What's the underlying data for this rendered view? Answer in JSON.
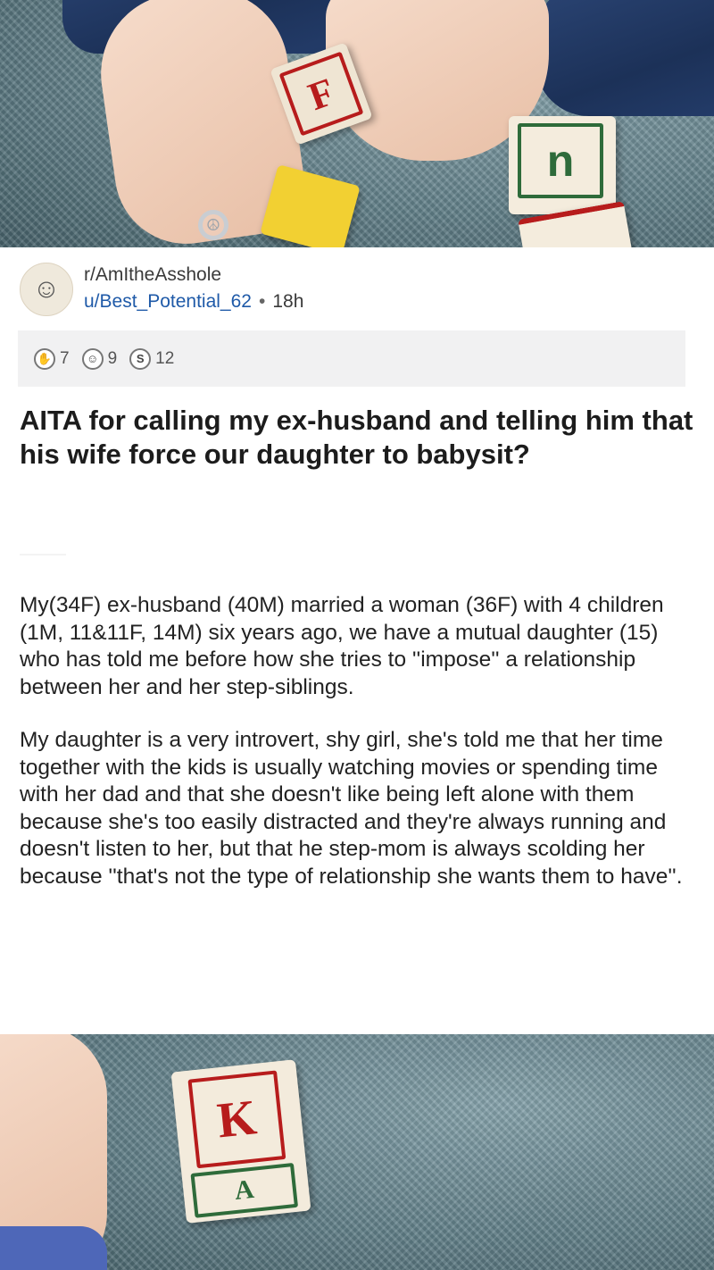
{
  "post": {
    "subreddit": "r/AmItheAsshole",
    "username": "u/Best_Potential_62",
    "age": "18h",
    "awards": [
      {
        "icon": "hands-icon",
        "count": "7"
      },
      {
        "icon": "wholesome-icon",
        "count": "9"
      },
      {
        "icon": "silver-icon",
        "count": "12"
      }
    ],
    "title": "AITA for calling my ex-husband and telling him that his wife force our daughter to babysit?",
    "paragraphs": [
      "My(34F) ex-husband (40M) married a woman (36F) with 4 children (1M, 11&11F, 14M) six years ago, we have a mutual daughter (15) who has told me before how she tries to ''impose'' a relationship between her and her step-siblings.",
      "My daughter is a very introvert, shy girl, she's told me that her time together with the kids is usually watching movies or spending time with her dad and that she doesn't like being left alone with them because she's too easily distracted and they're always running and doesn't listen to her, but that he step-mom is always scolding her because ''that's not the type of relationship she wants them to have''."
    ]
  },
  "photos": {
    "top_blocks": [
      "F",
      "n"
    ],
    "bottom_blocks": [
      "K",
      "A"
    ]
  },
  "colors": {
    "link": "#1f5aa8",
    "awards_bg": "#f1f1f2",
    "carpet": "#5f7d86",
    "block_red": "#b71c1c",
    "block_green": "#2e6b3a"
  }
}
